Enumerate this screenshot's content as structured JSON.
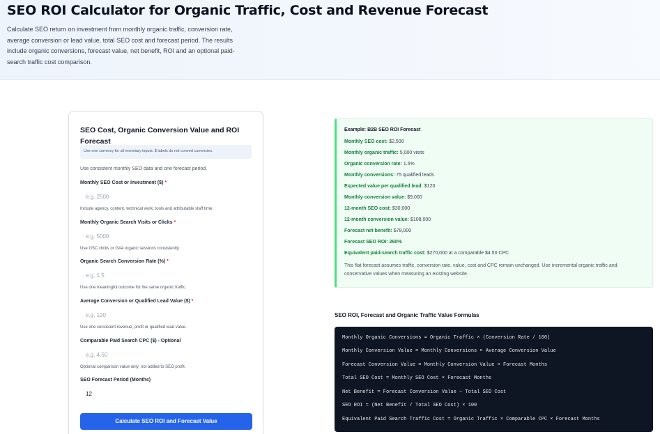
{
  "header": {
    "title": "SEO ROI Calculator for Organic Traffic, Cost and Revenue Forecast",
    "description": "Calculate SEO return on investment from monthly organic traffic, conversion rate, average conversion or lead value, total SEO cost and forecast period. The results include organic conversions, forecast value, net benefit, ROI and an optional paid-search traffic cost comparison."
  },
  "form": {
    "title": "SEO Cost, Organic Conversion Value and ROI Forecast",
    "currency_note": "Use one currency for all monetary inputs. $ labels do not convert currencies.",
    "intro": "Use consistent monthly SEO data and one forecast period.",
    "fields": [
      {
        "label": "Monthly SEO Cost or Investment ($)",
        "required": "*",
        "placeholder": "e.g. 2500",
        "help": "Include agency, content, technical work, tools and attributable staff time."
      },
      {
        "label": "Monthly Organic Search Visits or Clicks",
        "required": "*",
        "placeholder": "e.g. 5000",
        "help": "Use GSC clicks or GA4 organic sessions consistently."
      },
      {
        "label": "Organic Search Conversion Rate (%)",
        "required": "*",
        "placeholder": "e.g. 1.5",
        "help": "Use one meaningful outcome for the same organic traffic."
      },
      {
        "label": "Average Conversion or Qualified Lead Value ($)",
        "required": "*",
        "placeholder": "e.g. 120",
        "help": "Use one consistent revenue, profit or qualified lead value."
      },
      {
        "label": "Comparable Paid Search CPC ($) - Optional",
        "required": "",
        "placeholder": "e.g. 4.50",
        "help": "Optional comparison value only; not added to SEO profit."
      },
      {
        "label": "SEO Forecast Period (Months)",
        "required": "",
        "value": "12"
      }
    ],
    "submit_label": "Calculate SEO ROI and Forecast Value"
  },
  "example": {
    "title": "Example: B2B SEO ROI Forecast",
    "rows": [
      {
        "label": "Monthly SEO cost:",
        "value": "$2,500"
      },
      {
        "label": "Monthly organic traffic:",
        "value": "5,000 visits"
      },
      {
        "label": "Organic conversion rate:",
        "value": "1.5%"
      },
      {
        "label": "Monthly conversions:",
        "value": "75 qualified leads"
      },
      {
        "label": "Expected value per qualified lead:",
        "value": "$120"
      },
      {
        "label": "Monthly conversion value:",
        "value": "$9,000"
      },
      {
        "label": "12-month SEO cost:",
        "value": "$30,000"
      },
      {
        "label": "12-month conversion value:",
        "value": "$108,000"
      },
      {
        "label": "Forecast net benefit:",
        "value": "$78,000"
      },
      {
        "label": "Forecast SEO ROI:",
        "value": "260%"
      },
      {
        "label": "Equivalent paid-search traffic cost:",
        "value": "$270,000 at a comparable $4.50 CPC"
      }
    ],
    "note": "This flat forecast assumes traffic, conversion rate, value, cost and CPC remain unchanged. Use incremental organic traffic and conservative values when measuring an existing website."
  },
  "formulas": {
    "title": "SEO ROI, Forecast and Organic Traffic Value Formulas",
    "lines": [
      "Monthly Organic Conversions = Organic Traffic × (Conversion Rate / 100)",
      "Monthly Conversion Value = Monthly Conversions × Average Conversion Value",
      "Forecast Conversion Value = Monthly Conversion Value × Forecast Months",
      "Total SEO Cost = Monthly SEO Cost × Forecast Months",
      "Net Benefit = Forecast Conversion Value − Total SEO Cost",
      "SEO ROI = (Net Benefit / Total SEO Cost) × 100",
      "Equivalent Paid Search Traffic Cost = Organic Traffic × Comparable CPC × Forecast Months"
    ]
  },
  "colors": {
    "primary_button": "#2563eb",
    "example_accent": "#4ade80",
    "example_label": "#15803d",
    "code_background": "#0f1623",
    "required_marker": "#dc2626"
  }
}
